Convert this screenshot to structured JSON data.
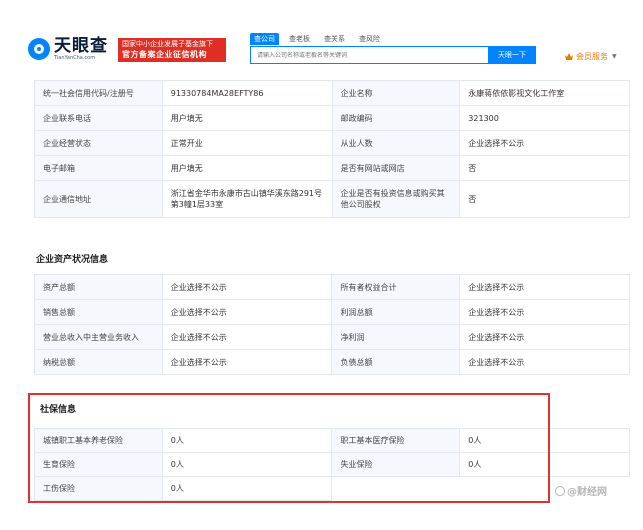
{
  "header": {
    "logo_cn": "天眼查",
    "logo_en": "TianYanCha.com",
    "badge_line1": "国家中小企业发展子基金旗下",
    "badge_line2": "官方备案企业征信机构",
    "tabs": [
      {
        "label": "查公司",
        "active": true
      },
      {
        "label": "查老板",
        "active": false
      },
      {
        "label": "查关系",
        "active": false
      },
      {
        "label": "查风险",
        "active": false
      }
    ],
    "search_placeholder": "请输入公司名称或老板名等关键词",
    "search_button": "天眼一下",
    "vip_label": "会员服务",
    "brand_color": "#0084ff",
    "badge_color": "#e02e24",
    "vip_color": "#e87b00"
  },
  "info_rows": [
    {
      "l1": "统一社会信用代码/注册号",
      "v1": "91330784MA28EFTY86",
      "l2": "企业名称",
      "v2": "永康蒋依依影视文化工作室"
    },
    {
      "l1": "企业联系电话",
      "v1": "用户填无",
      "l2": "邮政编码",
      "v2": "321300"
    },
    {
      "l1": "企业经营状态",
      "v1": "正常开业",
      "l2": "从业人数",
      "v2": "企业选择不公示"
    },
    {
      "l1": "电子邮箱",
      "v1": "用户填无",
      "l2": "是否有网站或网店",
      "v2": "否"
    },
    {
      "l1": "企业通信地址",
      "v1": "浙江省金华市永康市古山镇华溪东路291号第3幢1层33室",
      "l2": "企业是否有投资信息或购买其他公司股权",
      "v2": "否"
    }
  ],
  "asset_section": {
    "title": "企业资产状况信息",
    "rows": [
      {
        "l1": "资产总额",
        "v1": "企业选择不公示",
        "l2": "所有者权益合计",
        "v2": "企业选择不公示"
      },
      {
        "l1": "销售总额",
        "v1": "企业选择不公示",
        "l2": "利润总额",
        "v2": "企业选择不公示"
      },
      {
        "l1": "营业总收入中主营业务收入",
        "v1": "企业选择不公示",
        "l2": "净利润",
        "v2": "企业选择不公示"
      },
      {
        "l1": "纳税总额",
        "v1": "企业选择不公示",
        "l2": "负债总额",
        "v2": "企业选择不公示"
      }
    ]
  },
  "social_section": {
    "title": "社保信息",
    "highlight_color": "#e03131",
    "rows": [
      {
        "l1": "城镇职工基本养老保险",
        "v1": "0人",
        "l2": "职工基本医疗保险",
        "v2": "0人"
      },
      {
        "l1": "生育保险",
        "v1": "0人",
        "l2": "失业保险",
        "v2": "0人"
      },
      {
        "l1": "工伤保险",
        "v1": "0人"
      }
    ]
  },
  "watermark": "@财经网"
}
